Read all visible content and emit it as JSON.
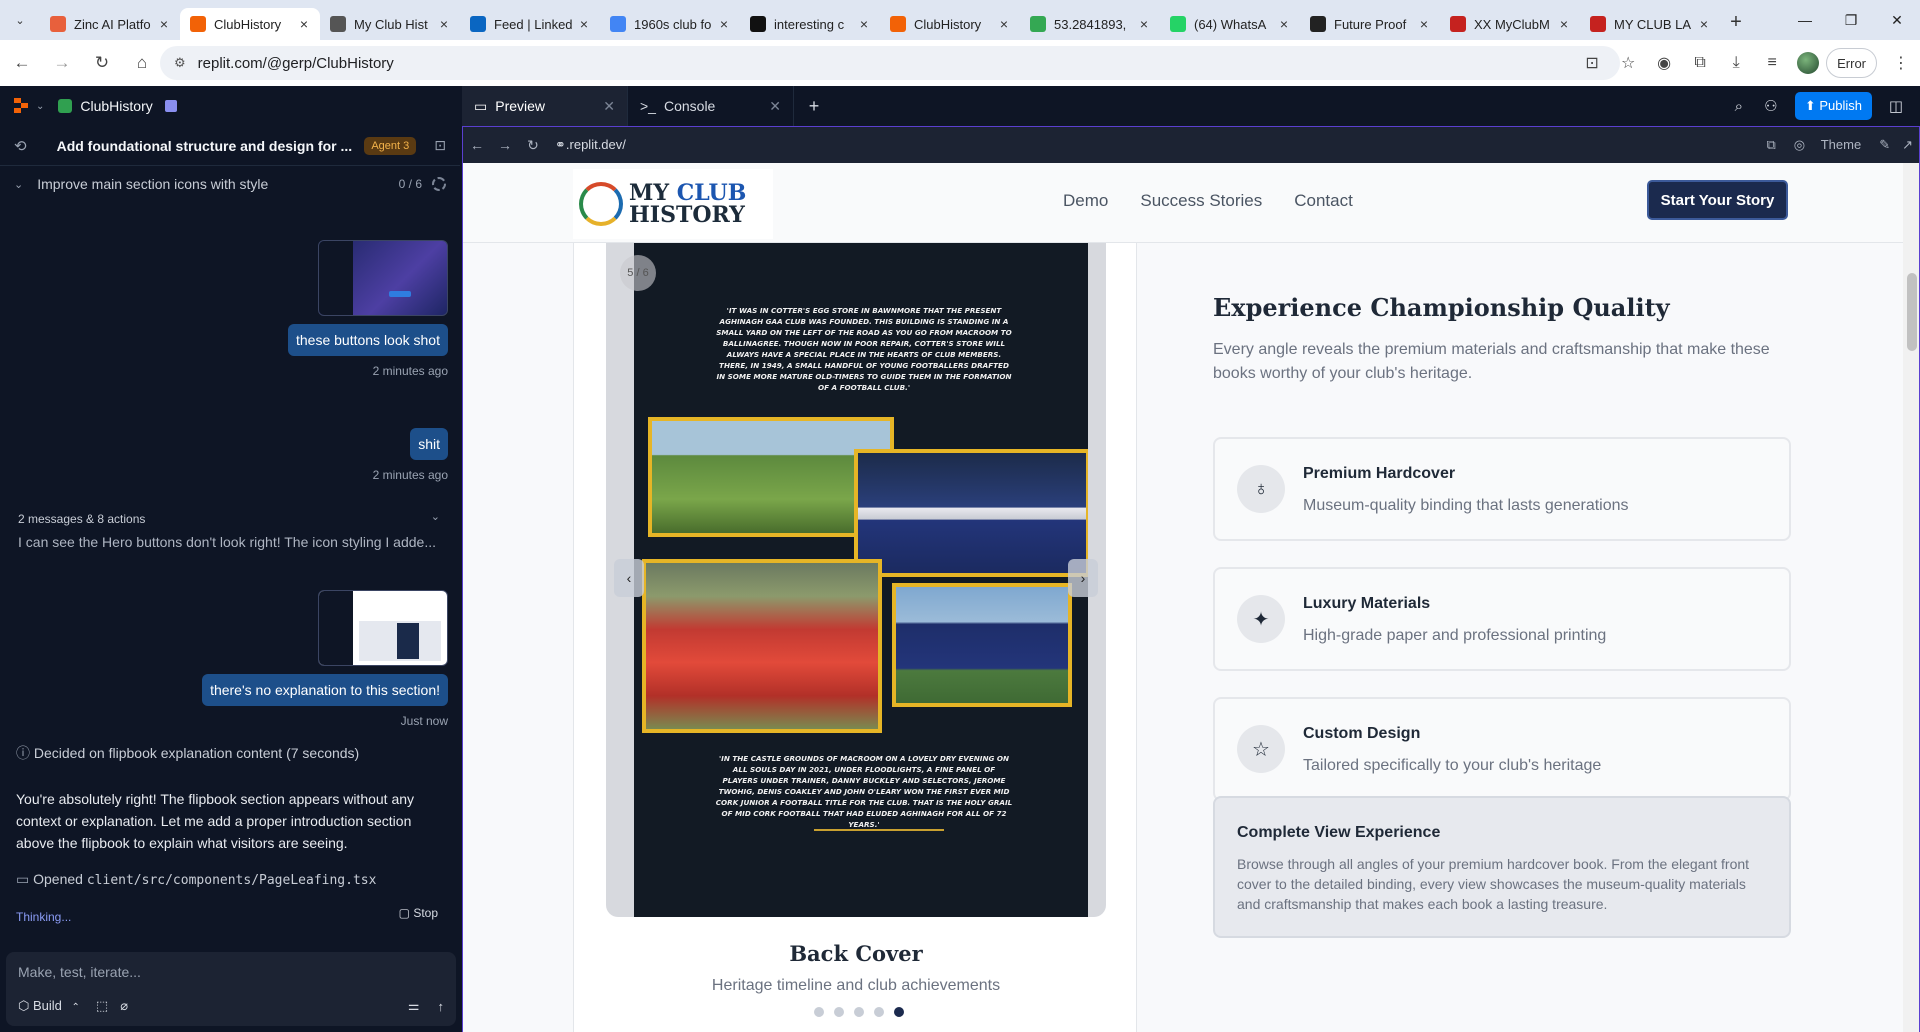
{
  "browser": {
    "tabs": [
      {
        "title": "Zinc AI Platfo",
        "color": "#e8603c"
      },
      {
        "title": "ClubHistory",
        "color": "#f26207",
        "active": true
      },
      {
        "title": "My Club Hist",
        "color": "#555555"
      },
      {
        "title": "Feed | Linked",
        "color": "#0a66c2"
      },
      {
        "title": "1960s club fo",
        "color": "#4285f4"
      },
      {
        "title": "interesting c",
        "color": "#111111"
      },
      {
        "title": "ClubHistory",
        "color": "#f26207"
      },
      {
        "title": "53.2841893,",
        "color": "#34a853"
      },
      {
        "title": "(64) WhatsA",
        "color": "#25d366"
      },
      {
        "title": "Future Proof",
        "color": "#222222"
      },
      {
        "title": "XX MyClubM",
        "color": "#c5221f"
      },
      {
        "title": "MY CLUB LA",
        "color": "#c5221f"
      }
    ],
    "url": "replit.com/@gerp/ClubHistory",
    "error_label": "Error"
  },
  "replit": {
    "project_name": "ClubHistory",
    "task_title": "Add foundational structure and design for ...",
    "agent_badge": "Agent 3",
    "step_label": "Improve main section icons with style",
    "step_count": "0 / 6",
    "messages": {
      "user1": "these buttons look shot",
      "user1_time": "2 minutes ago",
      "user2": "shit",
      "user2_time": "2 minutes ago",
      "collapsed_summary": "2 messages & 8 actions",
      "collapsed_preview": "I can see the Hero buttons don't look right! The icon styling I adde...",
      "user3": "there's no explanation to this section!",
      "user3_time": "Just now",
      "decision": "Decided on flipbook explanation content (7 seconds)",
      "reply": "You're absolutely right! The flipbook section appears without any context or explanation. Let me add a proper introduction section above the flipbook to explain what visitors are seeing.",
      "opened_prefix": "Opened",
      "opened_file": "client/src/components/PageLeafing.tsx",
      "thinking": "Thinking...",
      "stop": "Stop"
    },
    "input_placeholder": "Make, test, iterate...",
    "build_label": "Build",
    "workspace_tabs": [
      {
        "label": "Preview",
        "icon": "monitor-icon"
      },
      {
        "label": "Console",
        "icon": "terminal-icon"
      }
    ],
    "publish_label": "Publish",
    "preview_url": ".replit.dev/",
    "theme_label": "Theme"
  },
  "site": {
    "logo_line1_a": "MY",
    "logo_line1_b": "CLUB",
    "logo_line2": "HISTORY",
    "nav": [
      "Demo",
      "Success Stories",
      "Contact"
    ],
    "cta": "Start Your Story",
    "flipbook": {
      "page_indicator": "5 / 6",
      "quote_top": "'IT WAS IN COTTER'S EGG STORE IN BAWNMORE THAT THE PRESENT AGHINAGH GAA CLUB WAS FOUNDED. THIS BUILDING IS STANDING IN A SMALL YARD ON THE LEFT OF THE ROAD AS YOU GO FROM MACROOM TO BALLINAGREE. THOUGH NOW IN POOR REPAIR, COTTER'S STORE WILL ALWAYS HAVE A SPECIAL PLACE IN THE HEARTS OF CLUB MEMBERS. THERE, IN 1949, A SMALL HANDFUL OF YOUNG FOOTBALLERS DRAFTED IN SOME MORE MATURE OLD-TIMERS TO GUIDE THEM IN THE FORMATION OF A FOOTBALL CLUB.'",
      "quote_bottom": "'IN THE CASTLE GROUNDS OF MACROOM ON A LOVELY DRY EVENING ON ALL SOULS DAY IN 2021, UNDER FLOODLIGHTS, A FINE PANEL OF PLAYERS UNDER TRAINER, DANNY BUCKLEY AND SELECTORS, JEROME TWOHIG, DENIS COAKLEY AND JOHN O'LEARY WON THE FIRST EVER MID CORK JUNIOR A FOOTBALL TITLE FOR THE CLUB. THAT IS THE HOLY GRAIL OF MID CORK FOOTBALL THAT HAD ELUDED AGHINAGH FOR ALL OF 72 YEARS.'",
      "title": "Back Cover",
      "subtitle": "Heritage timeline and club achievements"
    },
    "experience": {
      "title": "Experience Championship Quality",
      "intro": "Every angle reveals the premium materials and craftsmanship that make these books worthy of your club's heritage.",
      "features": [
        {
          "title": "Premium Hardcover",
          "desc": "Museum-quality binding that lasts generations",
          "icon": "award-icon"
        },
        {
          "title": "Luxury Materials",
          "desc": "High-grade paper and professional printing",
          "icon": "sparkles-icon"
        },
        {
          "title": "Custom Design",
          "desc": "Tailored specifically to your club's heritage",
          "icon": "star-icon"
        }
      ],
      "complete_title": "Complete View Experience",
      "complete_desc": "Browse through all angles of your premium hardcover book. From the elegant front cover to the detailed binding, every view showcases the museum-quality materials and craftsmanship that makes each book a lasting treasure."
    }
  }
}
